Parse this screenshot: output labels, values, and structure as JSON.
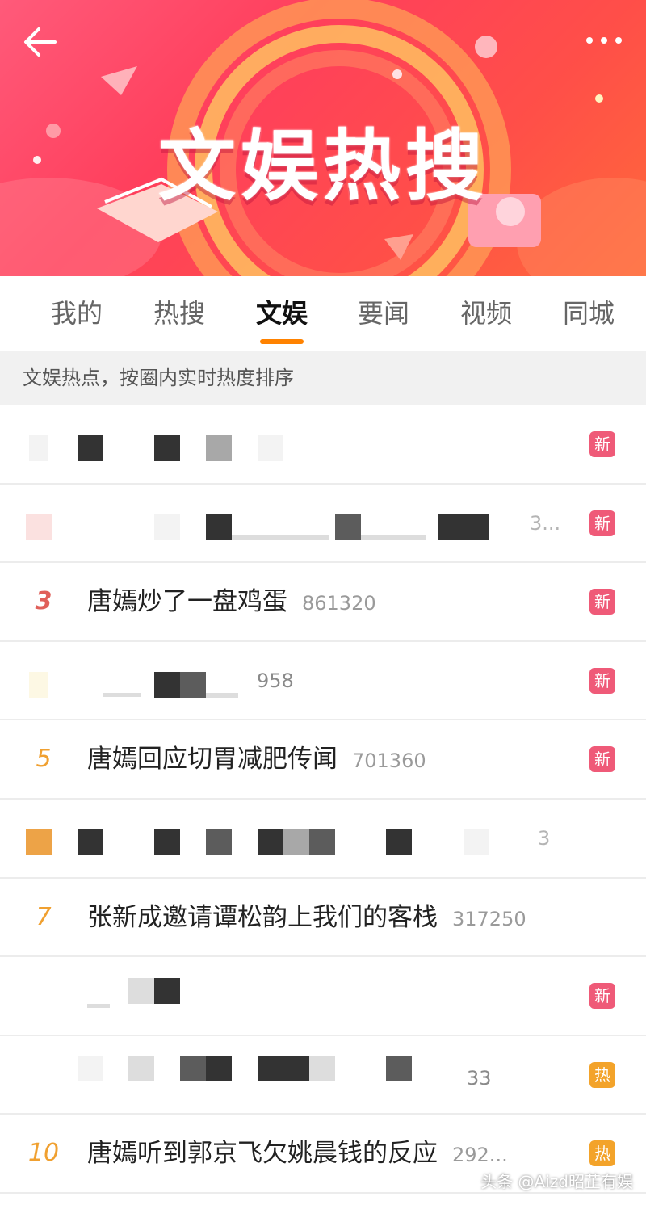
{
  "banner": {
    "title": "文娱热搜"
  },
  "tabs": [
    {
      "label": "我的"
    },
    {
      "label": "热搜"
    },
    {
      "label": "文娱"
    },
    {
      "label": "要闻"
    },
    {
      "label": "视频"
    },
    {
      "label": "同城"
    }
  ],
  "active_tab": "文娱",
  "subheader": "文娱热点，按圈内实时热度排序",
  "accent_color": "#ff8200",
  "badge_colors": {
    "new": "#ef5a78",
    "hot": "#f3a32a"
  },
  "list": [
    {
      "rank": "",
      "title": "",
      "count": "",
      "badge": "新"
    },
    {
      "rank": "",
      "title": "",
      "count": "3...",
      "badge": "新"
    },
    {
      "rank": "3",
      "title": "唐嫣炒了一盘鸡蛋",
      "count": "861320",
      "badge": "新"
    },
    {
      "rank": "",
      "title": "",
      "count": "958",
      "badge": "新"
    },
    {
      "rank": "5",
      "title": "唐嫣回应切胃减肥传闻",
      "count": "701360",
      "badge": "新"
    },
    {
      "rank": "",
      "title": "",
      "count": "3",
      "badge": ""
    },
    {
      "rank": "7",
      "title": "张新成邀请谭松韵上我们的客栈",
      "count": "317250",
      "badge": ""
    },
    {
      "rank": "",
      "title": "",
      "count": "",
      "badge": "新"
    },
    {
      "rank": "",
      "title": "",
      "count": "33",
      "badge": "热"
    },
    {
      "rank": "10",
      "title": "唐嫣听到郭京飞欠姚晨钱的反应",
      "count": "292...",
      "badge": "热"
    }
  ],
  "watermark": "头条 @Aizd昭芷有娱"
}
